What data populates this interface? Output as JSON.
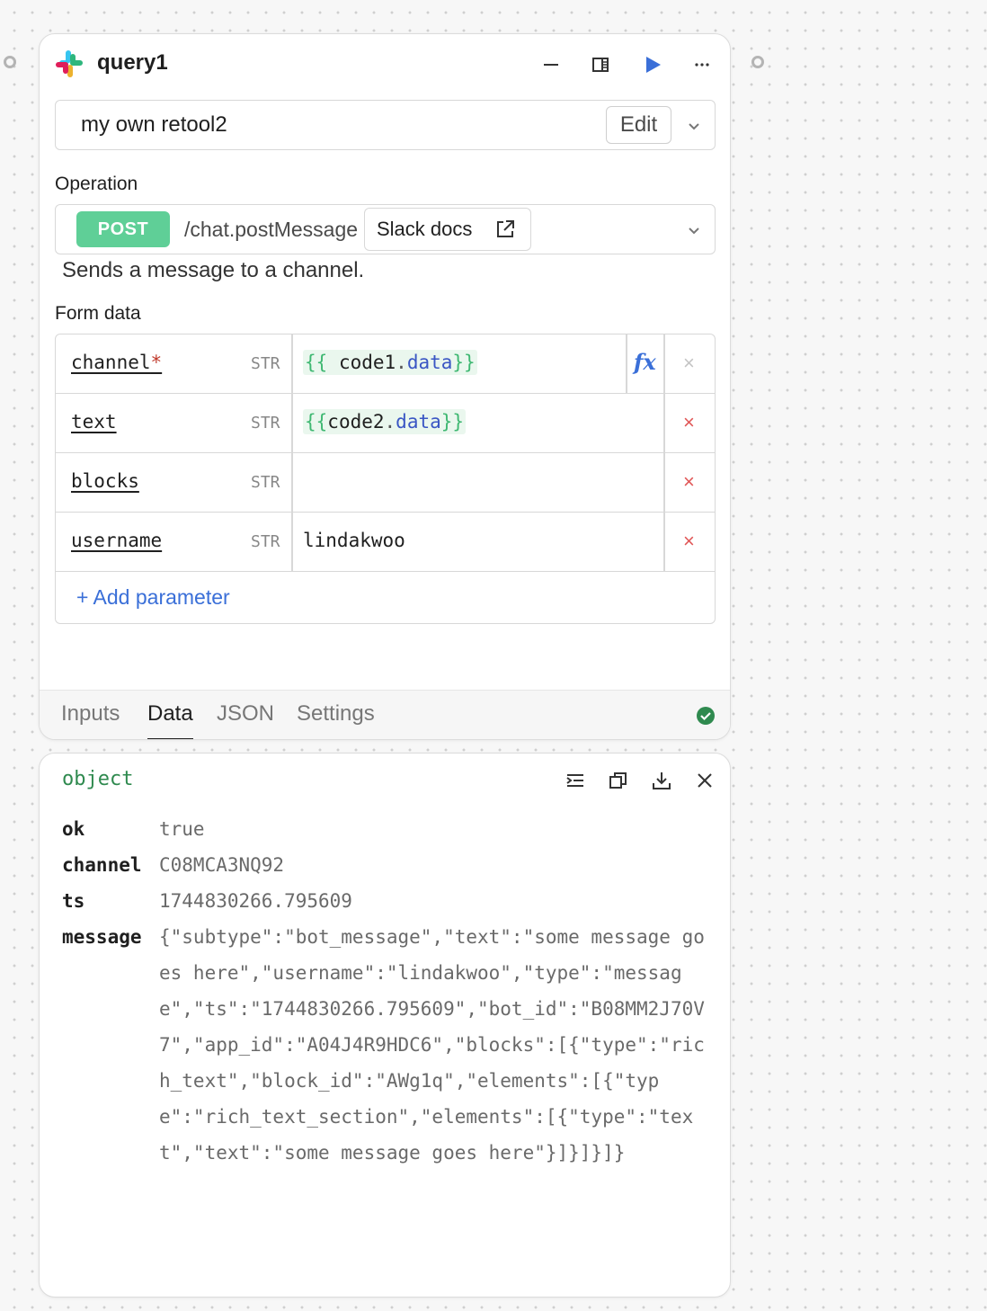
{
  "query": {
    "title": "query1",
    "resource": "my own retool2",
    "edit_label": "Edit",
    "operation_label": "Operation",
    "method": "POST",
    "endpoint": "/chat.postMessage",
    "docs_label": "Slack docs",
    "description": "Sends a message to a channel.",
    "form_label": "Form data",
    "params": [
      {
        "key": "channel",
        "type": "STR",
        "value_prefix": "{{ ",
        "value_obj": "code1",
        "value_prop": "data",
        "value_suffix": "}}"
      },
      {
        "key": "text",
        "type": "STR",
        "value_prefix": "{{",
        "value_obj": "code2",
        "value_prop": "data",
        "value_suffix": "}}"
      },
      {
        "key": "blocks",
        "type": "STR",
        "value": ""
      },
      {
        "key": "username",
        "type": "STR",
        "value": "lindakwoo"
      }
    ],
    "required_mark": "*",
    "fx_label": "fx",
    "delete_glyph": "×",
    "add_parameter": "+ Add parameter",
    "tabs": [
      "Inputs",
      "Data",
      "JSON",
      "Settings"
    ],
    "active_tab": "Data",
    "status": "success"
  },
  "result": {
    "type_label": "object",
    "rows": [
      {
        "key": "ok",
        "value": "true"
      },
      {
        "key": "channel",
        "value": "C08MCA3NQ92"
      },
      {
        "key": "ts",
        "value": "1744830266.795609"
      },
      {
        "key": "message",
        "value": "{\"subtype\":\"bot_message\",\"text\":\"some message goes here\",\"username\":\"lindakwoo\",\"type\":\"message\",\"ts\":\"1744830266.795609\",\"bot_id\":\"B08MM2J70V7\",\"app_id\":\"A04J4R9HDC6\",\"blocks\":[{\"type\":\"rich_text\",\"block_id\":\"AWg1q\",\"elements\":[{\"type\":\"rich_text_section\",\"elements\":[{\"type\":\"text\",\"text\":\"some message goes here\"}]}]}]}"
      }
    ]
  },
  "colors": {
    "accent": "#3a6fd8",
    "post_badge": "#5fcf97",
    "success": "#2f8a4f",
    "delete": "#e05656"
  },
  "icons": {
    "logo": "slack-logo",
    "minimize": "minimize-icon",
    "panel": "panel-toggle-icon",
    "run": "play-icon",
    "more": "more-icon",
    "external": "external-link-icon",
    "check": "check-circle-icon",
    "format": "format-icon",
    "copy": "copy-icon",
    "download": "download-icon",
    "close": "close-icon"
  }
}
